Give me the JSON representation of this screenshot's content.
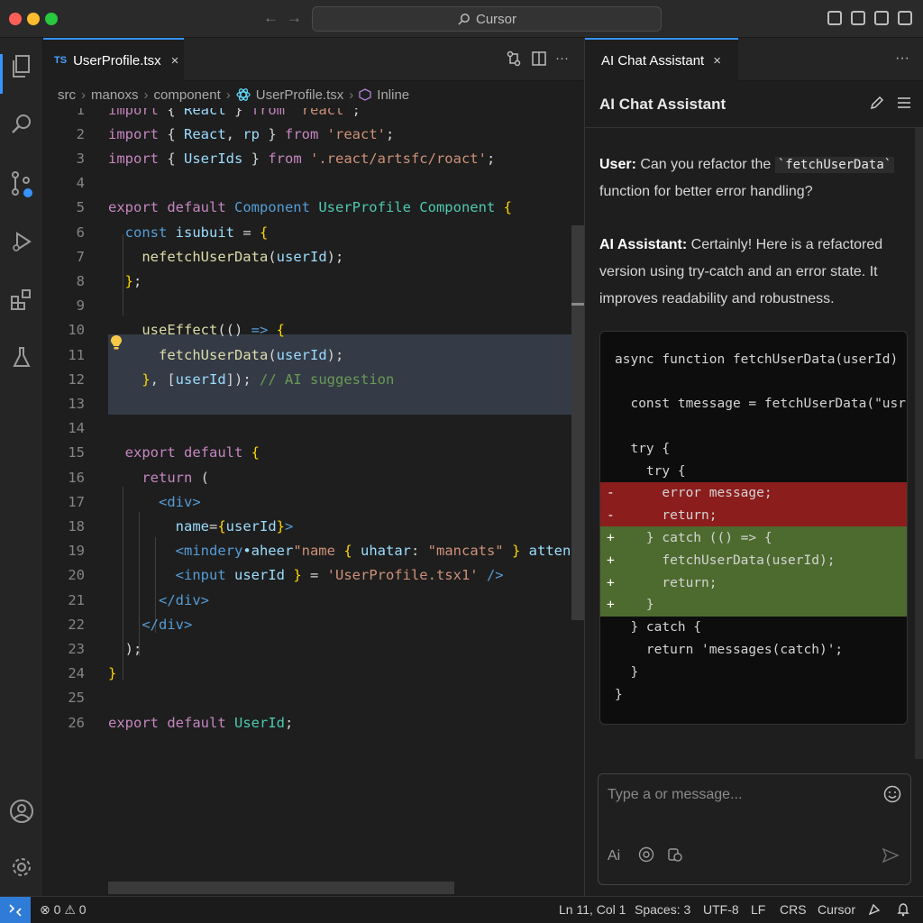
{
  "window": {
    "title": "Cursor",
    "nav_back": "←",
    "nav_forward": "→"
  },
  "editor": {
    "tab_badge": "TS",
    "tab_label": "UserProfile.tsx",
    "tab_close": "×",
    "breadcrumb": [
      "src",
      "manoxs",
      "component",
      "UserProfile.tsx",
      "Inline"
    ],
    "lines": [
      {
        "n": "1",
        "segs": [
          [
            "kw",
            "import"
          ],
          [
            "",
            " { "
          ],
          [
            "var",
            "React"
          ],
          [
            "",
            " } "
          ],
          [
            "kw",
            "from"
          ],
          [
            "str",
            " 'react'"
          ],
          [
            "",
            ";"
          ]
        ]
      },
      {
        "n": "2",
        "segs": [
          [
            "kw",
            "import"
          ],
          [
            "",
            " { "
          ],
          [
            "var",
            "React"
          ],
          [
            "",
            ", "
          ],
          [
            "var",
            "rp"
          ],
          [
            "",
            " } "
          ],
          [
            "kw",
            "from"
          ],
          [
            "str",
            " 'react'"
          ],
          [
            "",
            ";"
          ]
        ]
      },
      {
        "n": "3",
        "segs": [
          [
            "kw",
            "import"
          ],
          [
            "",
            " { "
          ],
          [
            "var",
            "UserIds"
          ],
          [
            "",
            " } "
          ],
          [
            "kw",
            "from"
          ],
          [
            "str",
            " '.react/artsfc/roact'"
          ],
          [
            "",
            ";"
          ]
        ]
      },
      {
        "n": "4",
        "segs": []
      },
      {
        "n": "5",
        "segs": [
          [
            "kw",
            "export"
          ],
          [
            "kw",
            " default"
          ],
          [
            "kw2",
            " Component"
          ],
          [
            "typ",
            " UserProfile"
          ],
          [
            "typ",
            " Component"
          ],
          [
            "brace",
            " {"
          ]
        ]
      },
      {
        "n": "6",
        "segs": [
          [
            "",
            "  "
          ],
          [
            "kw2",
            "const"
          ],
          [
            "var",
            " isubuit"
          ],
          [
            "",
            " = "
          ],
          [
            "brace",
            "{"
          ]
        ]
      },
      {
        "n": "7",
        "segs": [
          [
            "",
            "    "
          ],
          [
            "fn",
            "nefetchUserData"
          ],
          [
            "",
            "("
          ],
          [
            "var",
            "userId"
          ],
          [
            "",
            ");"
          ]
        ]
      },
      {
        "n": "8",
        "segs": [
          [
            "",
            "  "
          ],
          [
            "brace",
            "}"
          ],
          [
            "",
            ";"
          ]
        ]
      },
      {
        "n": "9",
        "segs": []
      },
      {
        "n": "10",
        "segs": [
          [
            "",
            "    "
          ],
          [
            "fn",
            "useEffect"
          ],
          [
            "",
            "(() "
          ],
          [
            "kw2",
            "=>"
          ],
          [
            "brace",
            " {"
          ]
        ]
      },
      {
        "n": "11",
        "segs": [
          [
            "",
            "      "
          ],
          [
            "fn",
            "fetchUserData"
          ],
          [
            "",
            "("
          ],
          [
            "var",
            "userId"
          ],
          [
            "",
            ");"
          ]
        ]
      },
      {
        "n": "12",
        "segs": [
          [
            "",
            "    "
          ],
          [
            "brace",
            "}"
          ],
          [
            "",
            ", ["
          ],
          [
            "var",
            "userId"
          ],
          [
            "",
            "]); "
          ],
          [
            "cm",
            "// AI suggestion"
          ]
        ]
      },
      {
        "n": "13",
        "segs": []
      },
      {
        "n": "14",
        "segs": []
      },
      {
        "n": "15",
        "segs": [
          [
            "",
            "  "
          ],
          [
            "kw",
            "export"
          ],
          [
            "kw",
            " default"
          ],
          [
            "brace",
            " {"
          ]
        ]
      },
      {
        "n": "16",
        "segs": [
          [
            "",
            "    "
          ],
          [
            "kw",
            "return"
          ],
          [
            "",
            " ("
          ]
        ]
      },
      {
        "n": "17",
        "segs": [
          [
            "",
            "      "
          ],
          [
            "tag",
            "<div>"
          ]
        ]
      },
      {
        "n": "18",
        "segs": [
          [
            "",
            "        "
          ],
          [
            "var",
            "name"
          ],
          [
            "",
            "="
          ],
          [
            "brace",
            "{"
          ],
          [
            "var",
            "userId"
          ],
          [
            "brace",
            "}"
          ],
          [
            "tag",
            ">"
          ]
        ]
      },
      {
        "n": "19",
        "segs": [
          [
            "",
            "        "
          ],
          [
            "tag",
            "<mindery"
          ],
          [
            "var",
            "•aheer"
          ],
          [
            "str",
            "\"name"
          ],
          [
            "brace",
            " {"
          ],
          [
            "var",
            " uhatar"
          ],
          [
            "",
            ": "
          ],
          [
            "str",
            "\"mancats\""
          ],
          [
            "brace",
            " }"
          ],
          [
            "var",
            " attenatal"
          ]
        ]
      },
      {
        "n": "20",
        "segs": [
          [
            "",
            "        "
          ],
          [
            "tag",
            "<input"
          ],
          [
            "var",
            " userId"
          ],
          [
            "brace",
            " }"
          ],
          [
            "",
            " = "
          ],
          [
            "str",
            "'UserProfile.tsx1'"
          ],
          [
            "tag",
            " />"
          ]
        ]
      },
      {
        "n": "21",
        "segs": [
          [
            "",
            "      "
          ],
          [
            "tag",
            "</div>"
          ]
        ]
      },
      {
        "n": "22",
        "segs": [
          [
            "",
            "    "
          ],
          [
            "tag",
            "</div>"
          ]
        ]
      },
      {
        "n": "23",
        "segs": [
          [
            "",
            "  "
          ],
          [
            "",
            ");"
          ]
        ]
      },
      {
        "n": "24",
        "segs": [
          [
            "brace",
            "}"
          ]
        ]
      },
      {
        "n": "25",
        "segs": []
      },
      {
        "n": "26",
        "segs": [
          [
            "kw",
            "export"
          ],
          [
            "kw",
            " default"
          ],
          [
            "typ",
            " UserId"
          ],
          [
            "",
            ";"
          ]
        ]
      }
    ]
  },
  "chat": {
    "tab_label": "AI Chat Assistant",
    "tab_close": "×",
    "more": "···",
    "header": "AI Chat Assistant",
    "user_label": "User:",
    "user_text_before": " Can you refactor the ",
    "user_code": "`fetchUserData`",
    "user_text_after": " function for better error handling?",
    "ai_label": "AI Assistant:",
    "ai_text": " Certainly! Here is a refactored version using try-catch and an error state. It improves readability and robustness.",
    "code_lines": [
      {
        "type": "",
        "mark": "",
        "text": "async function fetchUserData(userId) {"
      },
      {
        "type": "",
        "mark": "",
        "text": ""
      },
      {
        "type": "",
        "mark": "",
        "text": "  const tmessage = fetchUserData(\"usr'…"
      },
      {
        "type": "",
        "mark": "",
        "text": ""
      },
      {
        "type": "",
        "mark": "",
        "text": "  try {"
      },
      {
        "type": "",
        "mark": "",
        "text": "    try {"
      },
      {
        "type": "del",
        "mark": "-",
        "text": "      error message;"
      },
      {
        "type": "del",
        "mark": "-",
        "text": "      return;"
      },
      {
        "type": "add",
        "mark": "+",
        "text": "    } catch (() => {"
      },
      {
        "type": "add",
        "mark": "+",
        "text": "      fetchUserData(userId);"
      },
      {
        "type": "add",
        "mark": "+",
        "text": "      return;"
      },
      {
        "type": "add",
        "mark": "+",
        "text": "    }"
      },
      {
        "type": "",
        "mark": "",
        "text": "  } catch {"
      },
      {
        "type": "",
        "mark": "",
        "text": "    return 'messages(catch)';"
      },
      {
        "type": "",
        "mark": "",
        "text": "  }"
      },
      {
        "type": "",
        "mark": "",
        "text": "}"
      }
    ],
    "input_placeholder": "Type a or message...",
    "input_ai_label": "Ai"
  },
  "status": {
    "remote_icon": "remote-icon",
    "errors": "0",
    "warnings": "0",
    "position": "Ln 11, Col 1",
    "spaces": "Spaces: 3",
    "encoding": "UTF-8",
    "eol": "LF",
    "language": "CRS",
    "app": "Cursor"
  },
  "colors": {
    "accent": "#3794ff",
    "diff_removed": "#8c1d1d",
    "diff_added": "#4e6b2f",
    "suggestion_highlight": "#343b46"
  }
}
